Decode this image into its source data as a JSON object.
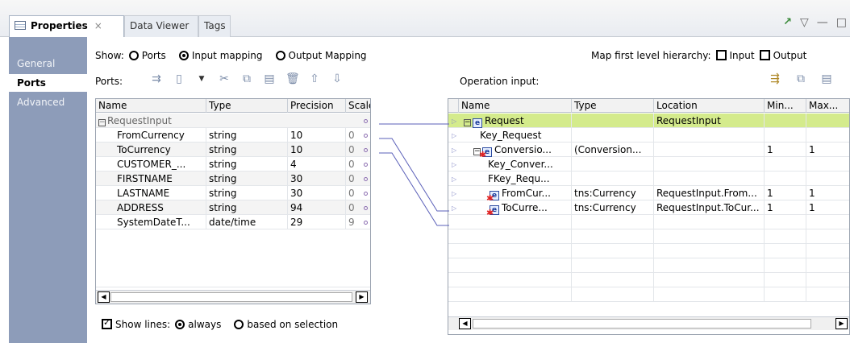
{
  "tabs": {
    "properties": "Properties",
    "close": "×",
    "data_viewer": "Data Viewer",
    "tags": "Tags"
  },
  "nav": [
    "General",
    "Ports",
    "Advanced"
  ],
  "show": {
    "label": "Show:",
    "ports": "Ports",
    "input_mapping": "Input mapping",
    "output_mapping": "Output Mapping",
    "selected": "input_mapping"
  },
  "map_hierarchy": {
    "label": "Map first level hierarchy:",
    "input": "Input",
    "output": "Output"
  },
  "ports_label": "Ports:",
  "operation_input_label": "Operation input:",
  "ports_table": {
    "headers": [
      "Name",
      "Type",
      "Precision",
      "Scale"
    ],
    "group": "RequestInput",
    "rows": [
      {
        "name": "FromCurrency",
        "type": "string",
        "precision": "10",
        "scale": "0"
      },
      {
        "name": "ToCurrency",
        "type": "string",
        "precision": "10",
        "scale": "0"
      },
      {
        "name": "CUSTOMER_...",
        "type": "string",
        "precision": "4",
        "scale": "0"
      },
      {
        "name": "FIRSTNAME",
        "type": "string",
        "precision": "30",
        "scale": "0"
      },
      {
        "name": "LASTNAME",
        "type": "string",
        "precision": "30",
        "scale": "0"
      },
      {
        "name": "ADDRESS",
        "type": "string",
        "precision": "94",
        "scale": "0"
      },
      {
        "name": "SystemDateT...",
        "type": "date/time",
        "precision": "29",
        "scale": "9"
      }
    ]
  },
  "op_table": {
    "headers": [
      "Name",
      "Type",
      "Location",
      "Min...",
      "Max..."
    ],
    "rows": [
      {
        "name": "Request",
        "type": "",
        "location": "RequestInput",
        "min": "",
        "max": ""
      },
      {
        "name": "Key_Request",
        "type": "",
        "location": "",
        "min": "",
        "max": ""
      },
      {
        "name": "Conversio...",
        "type": "(Conversion...",
        "location": "",
        "min": "1",
        "max": "1"
      },
      {
        "name": "Key_Conver...",
        "type": "",
        "location": "",
        "min": "",
        "max": ""
      },
      {
        "name": "FKey_Requ...",
        "type": "",
        "location": "",
        "min": "",
        "max": ""
      },
      {
        "name": "FromCur...",
        "type": "tns:Currency",
        "location": "RequestInput.From...",
        "min": "1",
        "max": "1"
      },
      {
        "name": "ToCurre...",
        "type": "tns:Currency",
        "location": "RequestInput.ToCur...",
        "min": "1",
        "max": "1"
      }
    ]
  },
  "show_lines": {
    "label": "Show lines:",
    "always": "always",
    "based_on_selection": "based on selection"
  },
  "colors": {
    "nav_bg": "#8d9cb9",
    "selected_row": "#d4eb8c",
    "link_line": "#5a5fb8"
  }
}
